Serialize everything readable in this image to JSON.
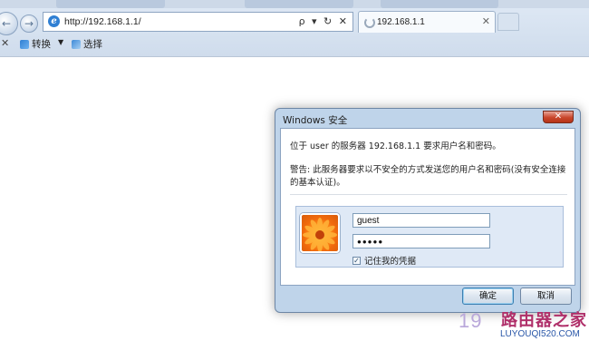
{
  "browser": {
    "address_url": "http://192.168.1.1/",
    "address_tools": "ρ ▾ ↻ ✕",
    "tab_title": "192.168.1.1",
    "tab_close": "✕",
    "command_bar": {
      "close_glyph": "✕",
      "convert_label": "转换",
      "select_label": "选择"
    }
  },
  "dialog": {
    "title": "Windows 安全",
    "close_glyph": "✕",
    "message": "位于 user 的服务器 192.168.1.1 要求用户名和密码。",
    "warning": "警告: 此服务器要求以不安全的方式发送您的用户名和密码(没有安全连接的基本认证)。",
    "username_value": "guest",
    "password_value": "●●●●●",
    "remember_label": "记住我的凭据",
    "remember_checked": "✓",
    "ok_label": "确定",
    "cancel_label": "取消"
  },
  "watermark": {
    "ip_text": "19",
    "brand_text": "路由器之家",
    "domain_text": "LUYOUQI520.COM"
  },
  "colors": {
    "chrome": "#cfdcec",
    "dialog_frame": "#bfd4ea",
    "close_button": "#c9462c",
    "watermark_brand": "#b0306a"
  }
}
